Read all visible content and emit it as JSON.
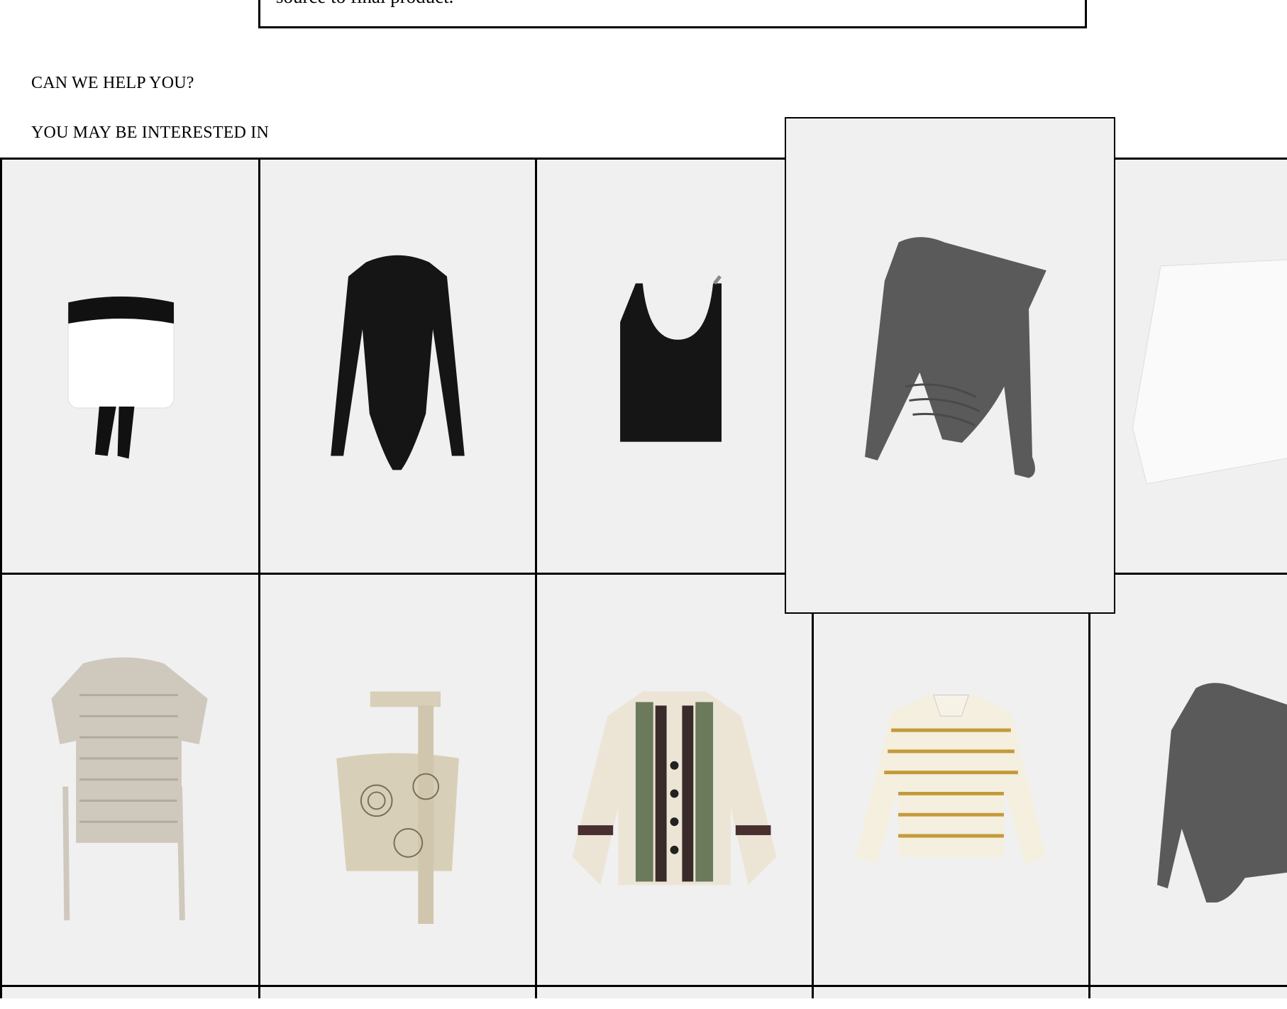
{
  "info_box": {
    "text": "source to final product."
  },
  "help_heading": "CAN WE HELP YOU?",
  "interested_heading": "YOU MAY BE INTERESTED IN",
  "products": [
    {
      "icon": "strapless-top-icon",
      "colors": [
        "#ffffff",
        "#111111"
      ]
    },
    {
      "icon": "long-sleeve-bodysuit-icon",
      "colors": [
        "#151515"
      ]
    },
    {
      "icon": "camisole-top-icon",
      "colors": [
        "#151515"
      ]
    },
    {
      "icon": "asymmetric-bodysuit-icon",
      "colors": [
        "#5a5a5a"
      ]
    },
    {
      "icon": "white-shirt-icon",
      "colors": [
        "#fafafa"
      ]
    },
    {
      "icon": "crochet-vest-icon",
      "colors": [
        "#cfc8bc"
      ]
    },
    {
      "icon": "printed-corset-top-icon",
      "colors": [
        "#d8cfb8"
      ]
    },
    {
      "icon": "patterned-cardigan-icon",
      "colors": [
        "#ece5d6",
        "#6b7a5a"
      ]
    },
    {
      "icon": "striped-polo-sweatshirt-icon",
      "colors": [
        "#f4efdf",
        "#c49a3a"
      ]
    },
    {
      "icon": "asymmetric-bodysuit-icon",
      "colors": [
        "#5a5a5a"
      ]
    }
  ]
}
